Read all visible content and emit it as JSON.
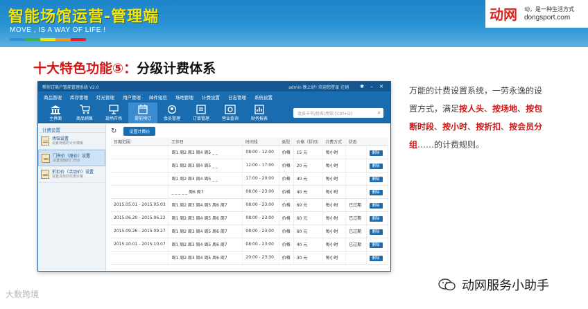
{
  "slide": {
    "title": "智能场馆运营-管理端",
    "slogan": "MOVE , IS A WAY OF LIFE !",
    "colorbar": [
      "#2f8fd8",
      "#39b54a",
      "#f3e500",
      "#f7941d",
      "#ed1c24"
    ],
    "logo": {
      "mark": "动网",
      "tagline": "动，是一种生活方式",
      "url": "dongsport.com"
    },
    "feature_title_red": "十大特色功能⑤：",
    "feature_title_black": "分级计费体系"
  },
  "app": {
    "window_title": "帮你订商户智能管理系统 V2.0",
    "user_info": "admin 晚上好! 欢迎您登录  注销",
    "menu": [
      "商品管理",
      "库存管理",
      "灯光管理",
      "用户管理",
      "邮件短信",
      "场地管理",
      "计费设置",
      "日志管理",
      "系统设置"
    ],
    "tools": [
      "主界面",
      "商品销售",
      "现场开场",
      "提前预订",
      "会员管理",
      "订单管理",
      "营业查询",
      "财务报表"
    ],
    "search_placeholder": "会员卡号/姓名/场馆  [Ctrl+D]",
    "sidebar": {
      "header": "计费设置",
      "items": [
        {
          "label": "场馆设置",
          "sub": "设置场馆的计价模板"
        },
        {
          "label": "门市价（原价）设置",
          "sub": "设置场馆的门市价"
        },
        {
          "label": "折扣价（活动价）设置",
          "sub": "设置具体的优惠价格"
        }
      ]
    },
    "content": {
      "button_label": "设置计费价",
      "columns": [
        "日期范围",
        "工作日",
        "时间段",
        "类型",
        "价格（折扣）",
        "计费方式",
        "状态",
        ""
      ],
      "delete_label": "删除",
      "rows": [
        {
          "date": "",
          "days": "周1 周2 周3 周4 周5 _  _",
          "time": "08:00 - 12:00",
          "type": "价格",
          "price": "15 元",
          "mode": "每小时",
          "status": ""
        },
        {
          "date": "",
          "days": "周1 周2 周3 周4 周5 _  _",
          "time": "12:00 - 17:00",
          "type": "价格",
          "price": "20 元",
          "mode": "每小时",
          "status": ""
        },
        {
          "date": "",
          "days": "周1 周2 周3 周4 周5 _  _",
          "time": "17:00 - 20:00",
          "type": "价格",
          "price": "40 元",
          "mode": "每小时",
          "status": ""
        },
        {
          "date": "",
          "days": "_  _  _  _  _  周6 周7",
          "time": "08:00 - 23:00",
          "type": "价格",
          "price": "40 元",
          "mode": "每小时",
          "status": ""
        },
        {
          "date": "2015.05.01 - 2015.05.03",
          "days": "周1 周2 周3 周4 周5 周6 周7",
          "time": "08:00 - 23:00",
          "type": "价格",
          "price": "60 元",
          "mode": "每小时",
          "status": "已过期"
        },
        {
          "date": "2015.06.20 - 2015.06.22",
          "days": "周1 周2 周3 周4 周5 周6 周7",
          "time": "08:00 - 23:00",
          "type": "价格",
          "price": "60 元",
          "mode": "每小时",
          "status": "已过期"
        },
        {
          "date": "2015.09.26 - 2015.09.27",
          "days": "周1 周2 周3 周4 周5 周6 周7",
          "time": "08:00 - 23:00",
          "type": "价格",
          "price": "60 元",
          "mode": "每小时",
          "status": "已过期"
        },
        {
          "date": "2015.10.01 - 2015.10.07",
          "days": "周1 周2 周3 周4 周5 周6 周7",
          "time": "08:00 - 23:00",
          "type": "价格",
          "price": "40 元",
          "mode": "每小时",
          "status": "已过期"
        },
        {
          "date": "",
          "days": "周1 周2 周3 周4 周5 周6 周7",
          "time": "20:00 - 23:30",
          "type": "价格",
          "price": "30 元",
          "mode": "每小时",
          "status": ""
        }
      ]
    }
  },
  "description": {
    "part1": "万能的计费设置系统，一劳永逸的设置方式，满足",
    "hl1": "按人头",
    "sep1": "、",
    "hl2": "按场地",
    "sep2": "、",
    "hl3": "按包断时段",
    "sep3": "、",
    "hl4": "按小时",
    "sep4": "、",
    "hl5": "按折扣",
    "sep5": "、",
    "hl6": "按会员分组",
    "part2": "……的计费规则。"
  },
  "watermarks": {
    "left": "大数跨境",
    "right": "动网服务小助手"
  }
}
